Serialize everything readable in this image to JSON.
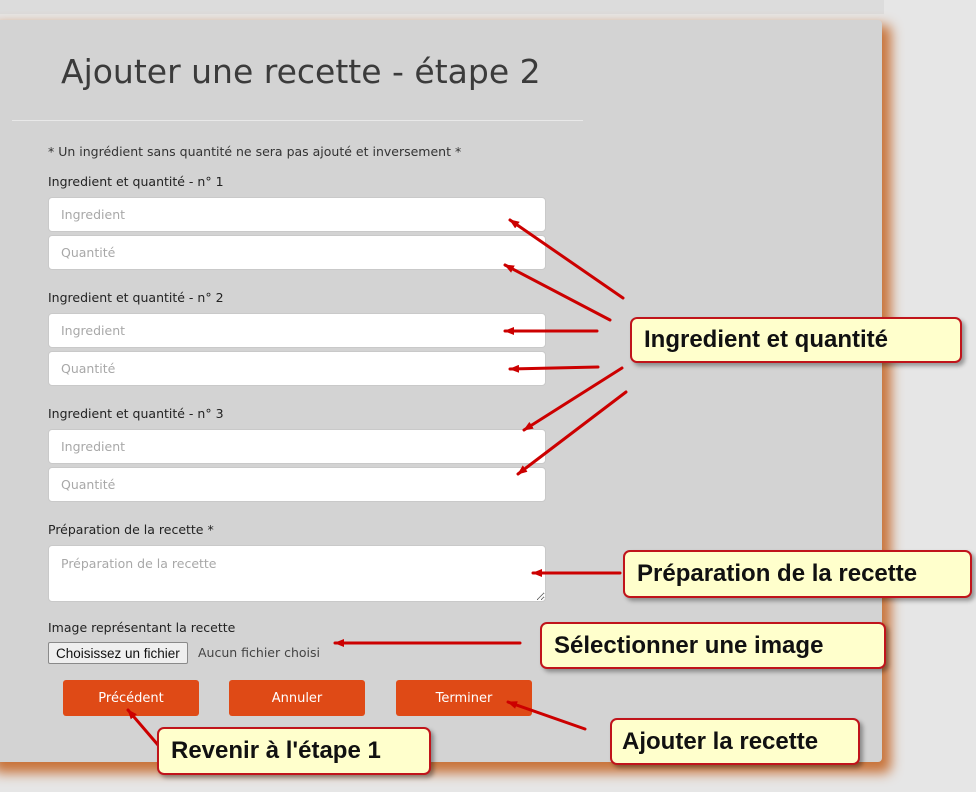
{
  "form": {
    "title": "Ajouter une recette - étape 2",
    "note": "* Un ingrédient sans quantité ne sera pas ajouté et inversement *",
    "ingredients": [
      {
        "label": "Ingredient et quantité - n° 1",
        "ingredient_placeholder": "Ingredient",
        "quantity_placeholder": "Quantité"
      },
      {
        "label": "Ingredient et quantité - n° 2",
        "ingredient_placeholder": "Ingredient",
        "quantity_placeholder": "Quantité"
      },
      {
        "label": "Ingredient et quantité - n° 3",
        "ingredient_placeholder": "Ingredient",
        "quantity_placeholder": "Quantité"
      }
    ],
    "preparation": {
      "label": "Préparation de la recette *",
      "placeholder": "Préparation de la recette"
    },
    "image": {
      "label": "Image représentant la recette",
      "button_label": "Choisissez un fichier",
      "status": "Aucun fichier choisi"
    },
    "buttons": {
      "previous": "Précédent",
      "cancel": "Annuler",
      "finish": "Terminer"
    }
  },
  "annotations": {
    "ingredients": "Ingredient et quantité",
    "preparation": "Préparation de la recette",
    "image": "Sélectionner une image",
    "finish": "Ajouter la recette",
    "previous": "Revenir à l'étape 1"
  },
  "colors": {
    "button": "#df4a16",
    "card": "#d3d3d3",
    "card_shadow": "#c8733a",
    "callout_fill": "#ffffcc",
    "callout_border": "#c0141b",
    "arrow": "#cc0000"
  }
}
